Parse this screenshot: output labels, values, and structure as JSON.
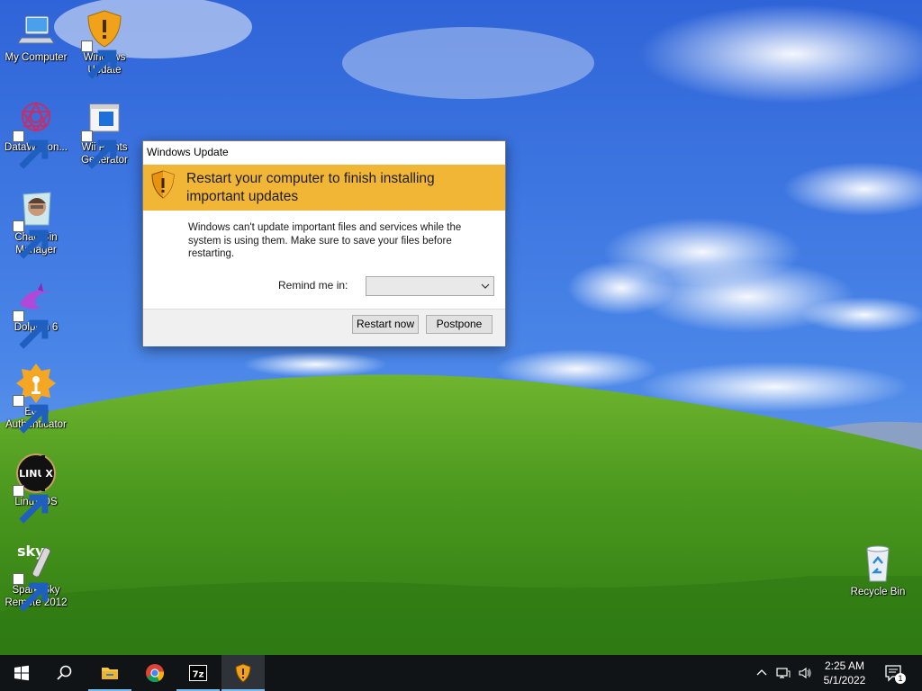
{
  "desktop": {
    "icons": [
      {
        "label": "My Computer",
        "icon": "computer-icon"
      },
      {
        "label": "Windows Update",
        "icon": "windows-update-shield-icon"
      },
      {
        "label": "DataWagon...",
        "icon": "datawagon-icon"
      },
      {
        "label": "Wii Points Generator",
        "icon": "wii-points-generator-icon"
      },
      {
        "label": "Chad Bin Manager",
        "icon": "chad-bin-manager-icon"
      },
      {
        "label": "Dolphin 6",
        "icon": "dolphin-icon"
      },
      {
        "label": "EOQ Authenticator",
        "icon": "eoq-authenticator-icon"
      },
      {
        "label": "Linux OS",
        "icon": "linux-os-icon"
      },
      {
        "label": "Spare Sky Remote 2012",
        "icon": "sky-remote-icon"
      },
      {
        "label": "Recycle Bin",
        "icon": "recycle-bin-icon"
      }
    ]
  },
  "dialog": {
    "title": "Windows Update",
    "heading": "Restart your computer to finish installing important updates",
    "message": "Windows can't update important files and services while the system is using them. Make sure to save your files before restarting.",
    "remind_label": "Remind me in:",
    "remind_value": "",
    "restart_label": "Restart now",
    "postpone_label": "Postpone",
    "banner_color": "#f2b637"
  },
  "taskbar": {
    "apps": [
      {
        "name": "start",
        "icon": "windows-logo-icon"
      },
      {
        "name": "search",
        "icon": "search-icon"
      },
      {
        "name": "file-explorer",
        "icon": "folder-icon"
      },
      {
        "name": "chrome",
        "icon": "chrome-icon"
      },
      {
        "name": "7zip",
        "icon": "7zip-icon"
      },
      {
        "name": "windows-update",
        "icon": "windows-update-shield-icon",
        "active": true
      }
    ],
    "clock": {
      "time": "2:25 AM",
      "date": "5/1/2022"
    },
    "notification_count": "1"
  }
}
